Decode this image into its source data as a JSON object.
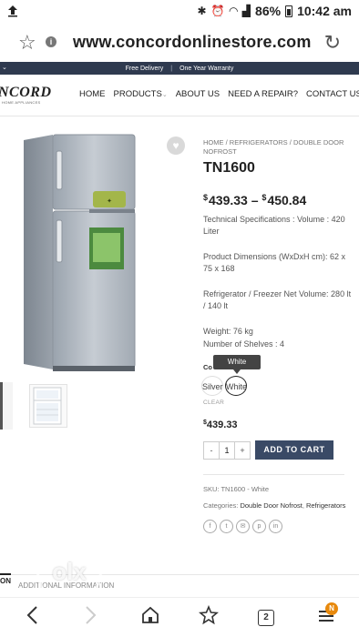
{
  "status_bar": {
    "battery": "86%",
    "time": "10:42 am"
  },
  "browser": {
    "url": "www.concordonlinestore.com"
  },
  "promo": {
    "left": "Free Delivery",
    "separator": "|",
    "right": "One Year Warranty"
  },
  "site": {
    "logo": "NCORD",
    "logo_sub": "HOME APPLIANCES",
    "nav": [
      "HOME",
      "PRODUCTS",
      "ABOUT US",
      "NEED A REPAIR?",
      "CONTACT US"
    ]
  },
  "product": {
    "breadcrumb": {
      "home": "HOME",
      "sep": "/",
      "cat": "REFRIGERATORS",
      "sub": "DOUBLE DOOR NOFROST"
    },
    "title": "TN1600",
    "price_low": "439.33",
    "price_high": "450.84",
    "currency": "$",
    "price_sep": "–",
    "specs": [
      "Technical Specifications : Volume : 420 Liter",
      "Product Dimensions (WxDxH cm): 62 x 75 x 168",
      "Refrigerator / Freezer Net Volume: 280 lt / 140 lt",
      "Weight: 76 kg",
      "Number of Shelves : 4"
    ],
    "color_label": "Co",
    "tooltip": "White",
    "swatches": [
      "Silver",
      "White"
    ],
    "clear": "CLEAR",
    "variant_price": "439.33",
    "quantity": "1",
    "qty_minus": "-",
    "qty_plus": "+",
    "add_to_cart": "ADD TO CART",
    "sku_label": "SKU:",
    "sku_value": "TN1600 - White",
    "categories_label": "Categories:",
    "category_1": "Double Door Nofrost",
    "category_sep": ",",
    "category_2": "Refrigerators"
  },
  "tabs": {
    "active": "ON",
    "next": "ADDITIONAL INFORMATION"
  },
  "watermark": "olx",
  "bottom_nav": {
    "tabs_count": "2",
    "menu_badge": "N"
  }
}
